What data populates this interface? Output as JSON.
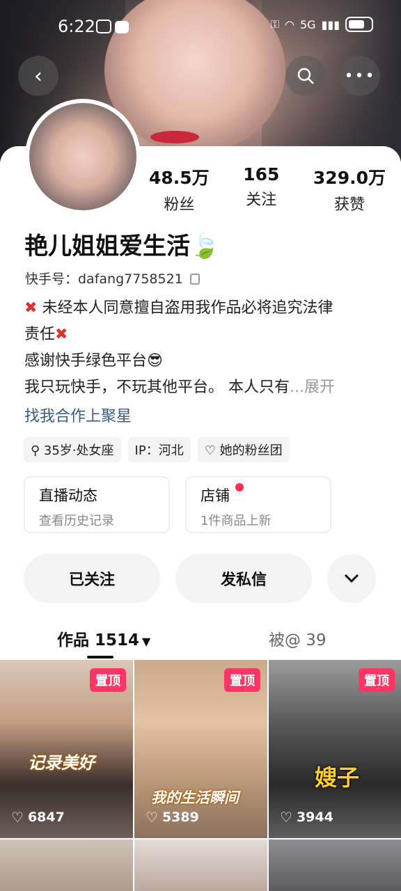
{
  "status": {
    "time": "6:22",
    "network": "5G"
  },
  "profile": {
    "nickname": "艳儿姐姐爱生活🍃",
    "kuaishou_id": "快手号：dafang7758521",
    "stats": [
      {
        "value": "48.5万",
        "label": "粉丝"
      },
      {
        "value": "165",
        "label": "关注"
      },
      {
        "value": "329.0万",
        "label": "获赞"
      }
    ],
    "bio": {
      "line1": "未经本人同意擅自盗用我作品必将追究法律",
      "line2": "责任",
      "line3": "感谢快手绿色平台😎",
      "line4": "我只玩快手，不玩其他平台。 本人只有",
      "expand": "...展开"
    },
    "cooperate": "找我合作上聚星",
    "tags": [
      "35岁·处女座",
      "IP：河北",
      "她的粉丝团"
    ]
  },
  "cards": [
    {
      "title": "直播动态",
      "sub": "查看历史记录"
    },
    {
      "title": "店铺",
      "sub": "1件商品上新"
    }
  ],
  "actions": {
    "followed": "已关注",
    "message": "发私信"
  },
  "tabs": {
    "works": "作品 1514",
    "mentioned": "被@ 39"
  },
  "videos": [
    {
      "pinned": "置顶",
      "caption": "记录美好",
      "likes": "6847"
    },
    {
      "pinned": "置顶",
      "caption": "我的生活瞬间",
      "likes": "5389"
    },
    {
      "pinned": "置顶",
      "caption": "嫂子",
      "likes": "3944"
    }
  ],
  "colors": {
    "accent": "#fe3666",
    "link": "#3a5b80"
  }
}
